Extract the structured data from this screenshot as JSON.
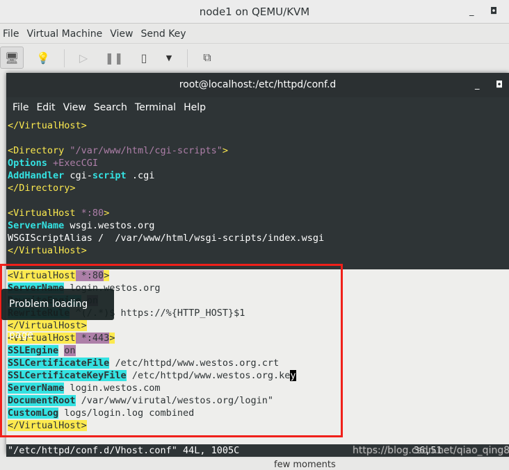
{
  "window": {
    "title": "node1 on QEMU/KVM"
  },
  "menubar": [
    "File",
    "Virtual Machine",
    "View",
    "Send Key"
  ],
  "toolbar": {
    "icons": [
      "console-monitor-icon",
      "details-lightbulb-icon",
      "run-play-icon",
      "pause-icon",
      "power-icon",
      "power-dropdown-icon",
      "snapshot-icon"
    ]
  },
  "terminal": {
    "title": "root@localhost:/etc/httpd/conf.d",
    "menu": [
      "File",
      "Edit",
      "View",
      "Search",
      "Terminal",
      "Help"
    ],
    "dark_lines": [
      [
        {
          "t": "</VirtualHost>",
          "c": "tag"
        }
      ],
      [],
      [
        {
          "t": "<Directory ",
          "c": "tag"
        },
        {
          "t": "\"/var/www/html/cgi-scripts\"",
          "c": "str"
        },
        {
          "t": ">",
          "c": "tag"
        }
      ],
      [
        {
          "t": "Options",
          "c": "kw"
        },
        {
          "t": " +ExecCGI",
          "c": "str"
        }
      ],
      [
        {
          "t": "AddHandler",
          "c": "kw"
        },
        {
          "t": " cgi-"
        },
        {
          "t": "script",
          "c": "kw"
        },
        {
          "t": " .cgi"
        }
      ],
      [
        {
          "t": "</Directory>",
          "c": "tag"
        }
      ],
      [],
      [
        {
          "t": "<VirtualHost ",
          "c": "tag"
        },
        {
          "t": "*:80",
          "c": "str"
        },
        {
          "t": ">",
          "c": "tag"
        }
      ],
      [
        {
          "t": "ServerName",
          "c": "kw"
        },
        {
          "t": " wsgi.westos.org"
        }
      ],
      [
        {
          "t": "WSGIScriptAlias /  /var/www/html/wsgi-scripts/index.wsgi"
        }
      ],
      [
        {
          "t": "</VirtualHost>",
          "c": "tag"
        }
      ]
    ],
    "light_lines": [
      [
        {
          "t": "<VirtualHost",
          "c": "btag"
        },
        {
          "t": " *:80",
          "c": "bstr"
        },
        {
          "t": ">",
          "c": "btag"
        }
      ],
      [
        {
          "t": "ServerName",
          "c": "bkw"
        },
        {
          "t": " login.westos.org"
        }
      ],
      [
        {
          "t": "RewriteEngine",
          "c": "bkw"
        },
        {
          "t": " "
        },
        {
          "t": "on",
          "c": "bstr"
        }
      ],
      [
        {
          "t": "RewriteRule",
          "c": "bkw"
        },
        {
          "t": " ^(/.*)$ https://%{HTTP_HOST}$1"
        }
      ],
      [
        {
          "t": "</VirtualHost>",
          "c": "btag"
        }
      ],
      [
        {
          "t": "<VirtualHost",
          "c": "btag"
        },
        {
          "t": " *:443",
          "c": "bstr"
        },
        {
          "t": ">",
          "c": "btag"
        }
      ],
      [
        {
          "t": "SSLEngine",
          "c": "bkw"
        },
        {
          "t": " "
        },
        {
          "t": "on",
          "c": "bstr"
        }
      ],
      [
        {
          "t": "SSLCertificateFile",
          "c": "bkw"
        },
        {
          "t": " /etc/httpd/www.westos.org.crt"
        }
      ],
      [
        {
          "t": "SSLCertificateKeyFile",
          "c": "bkw"
        },
        {
          "t": " /etc/httpd/www.westos.org.ke"
        },
        {
          "t": "y",
          "c": "cur"
        }
      ],
      [
        {
          "t": "ServerName",
          "c": "bkw"
        },
        {
          "t": " login.westos.com"
        }
      ],
      [
        {
          "t": "DocumentRoot",
          "c": "bkw"
        },
        {
          "t": " /var/www/virutal/westos.org/login\""
        }
      ],
      [
        {
          "t": "CustomLog",
          "c": "bkw"
        },
        {
          "t": " logs/login.log combined"
        }
      ],
      [
        {
          "t": "</VirtualHost>",
          "c": "btag"
        }
      ]
    ],
    "status": "\"/etc/httpd/conf.d/Vhost.conf\" 44L, 1005C",
    "cursor_pos": "36,51"
  },
  "tooltip": "Problem loading page",
  "watermark": "https://blog.csdn.net/qiao_qing8",
  "background_text": "few moments",
  "colors": {
    "highlight_box": "#f0201a",
    "tag": "#fce94f",
    "keyword": "#34e2e2",
    "string": "#ad7fa8"
  }
}
